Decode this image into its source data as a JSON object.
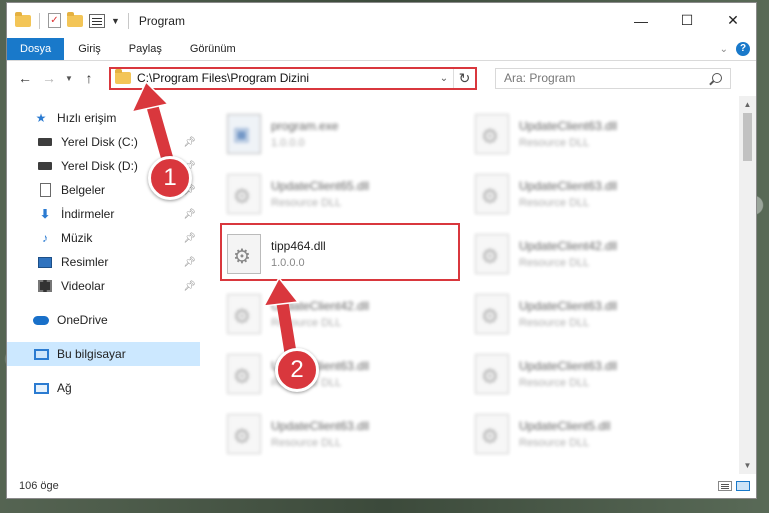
{
  "window": {
    "title": "Program",
    "minimize": "—",
    "maximize": "☐",
    "close": "✕"
  },
  "ribbon": {
    "tabs": [
      "Dosya",
      "Giriş",
      "Paylaş",
      "Görünüm"
    ],
    "help": "?"
  },
  "address": {
    "path": "C:\\Program Files\\Program Dizini",
    "search_placeholder": "Ara: Program"
  },
  "sidebar": {
    "items": [
      {
        "label": "Hızlı erişim",
        "icon": "quick-access-star-icon"
      },
      {
        "label": "Yerel Disk (C:)",
        "icon": "disk-icon",
        "pinned": true
      },
      {
        "label": "Yerel Disk (D:)",
        "icon": "disk-icon",
        "pinned": true
      },
      {
        "label": "Belgeler",
        "icon": "documents-icon",
        "pinned": true
      },
      {
        "label": "İndirmeler",
        "icon": "downloads-icon",
        "pinned": true
      },
      {
        "label": "Müzik",
        "icon": "music-icon",
        "pinned": true
      },
      {
        "label": "Resimler",
        "icon": "pictures-icon",
        "pinned": true
      },
      {
        "label": "Videolar",
        "icon": "videos-icon",
        "pinned": true
      },
      {
        "label": "OneDrive",
        "icon": "onedrive-icon"
      },
      {
        "label": "Bu bilgisayar",
        "icon": "this-pc-icon",
        "selected": true
      },
      {
        "label": "Ağ",
        "icon": "network-icon"
      }
    ]
  },
  "files": [
    {
      "name": "program.exe",
      "sub": "1.0.0.0",
      "blurred": true
    },
    {
      "name": "UpdateClient63.dll",
      "sub": "Resource DLL",
      "blurred": true
    },
    {
      "name": "UpdateClient65.dll",
      "sub": "Resource DLL",
      "blurred": true
    },
    {
      "name": "UpdateClient63.dll",
      "sub": "Resource DLL",
      "blurred": true
    },
    {
      "name": "tipp464.dll",
      "sub": "1.0.0.0",
      "blurred": false
    },
    {
      "name": "UpdateClient42.dll",
      "sub": "Resource DLL",
      "blurred": true
    },
    {
      "name": "UpdateClient42.dll",
      "sub": "Resource DLL",
      "blurred": true
    },
    {
      "name": "UpdateClient63.dll",
      "sub": "Resource DLL",
      "blurred": true
    },
    {
      "name": "UpdateClient63.dll",
      "sub": "Resource DLL",
      "blurred": true
    },
    {
      "name": "UpdateClient63.dll",
      "sub": "Resource DLL",
      "blurred": true
    },
    {
      "name": "UpdateClient63.dll",
      "sub": "Resource DLL",
      "blurred": true
    },
    {
      "name": "UpdateClient5.dll",
      "sub": "Resource DLL",
      "blurred": true
    }
  ],
  "status": {
    "count": "106 öge"
  },
  "annotations": {
    "step1": "1",
    "step2": "2",
    "color": "#d9373d"
  }
}
